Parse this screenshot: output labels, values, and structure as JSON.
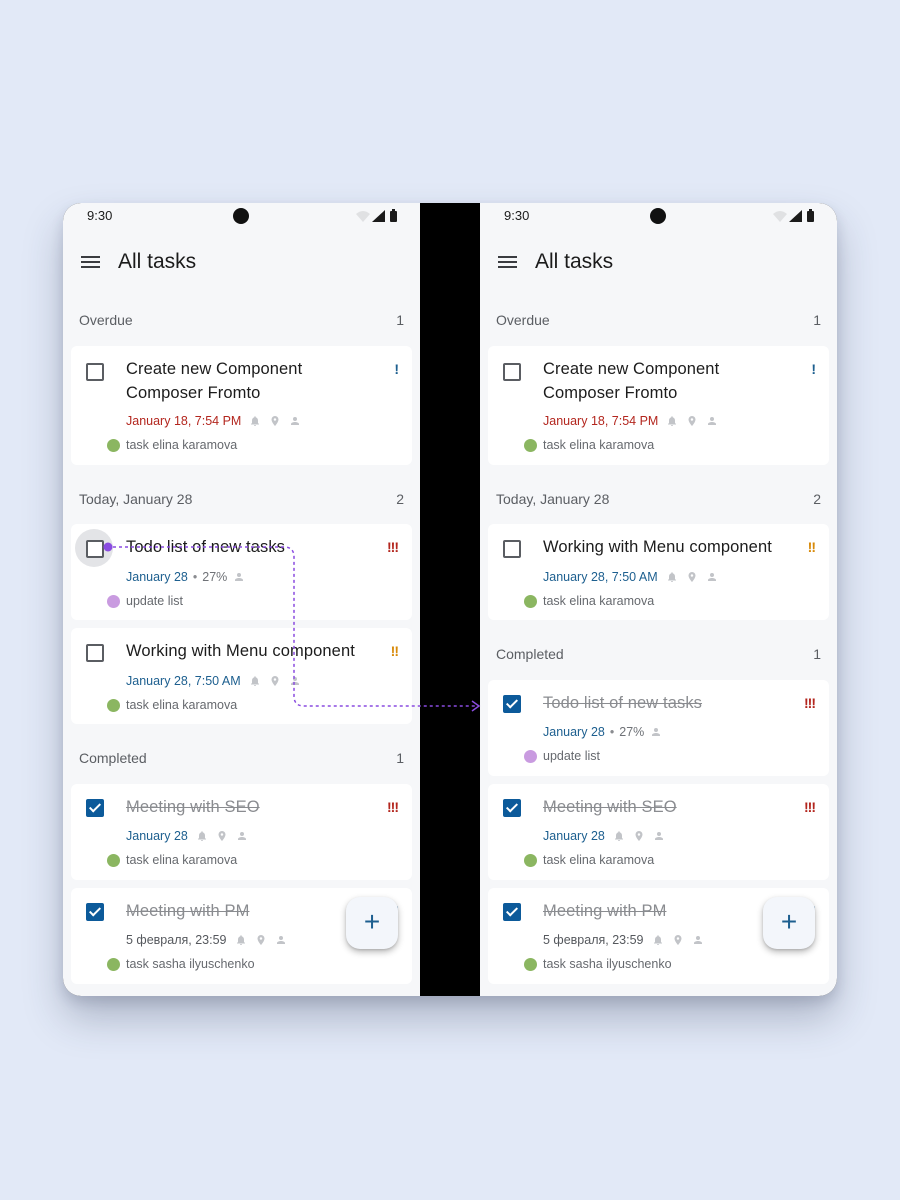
{
  "status": {
    "time": "9:30"
  },
  "appbar": {
    "title": "All tasks"
  },
  "colors": {
    "background": "#e2e9f7",
    "accent": "#0c5a9a",
    "date": "#1d5f8f",
    "overdue": "#b3261e",
    "priority_high": "#b3261e",
    "priority_medium": "#d88a0a",
    "priority_low": "#1d5f8f",
    "tag_green": "#8bb661",
    "tag_purple": "#c99be0",
    "drag_path": "#8a4ce0"
  },
  "left": {
    "sections": {
      "overdue": {
        "label": "Overdue",
        "count": "1"
      },
      "today": {
        "label": "Today, January 28",
        "count": "2"
      },
      "completed": {
        "label": "Completed",
        "count": "1"
      }
    },
    "tasks": [
      {
        "title_line1": "Create new Component",
        "title_line2": "Composer Fromto",
        "priority": "!",
        "date": "January 18, 7:54 PM",
        "tag": "task elina karamova",
        "checked": false
      },
      {
        "title": "Todo list of new tasks",
        "priority": "!!!",
        "date": "January 28",
        "progress": "27%",
        "tag": "update list",
        "checked": false
      },
      {
        "title": "Working with Menu component",
        "priority": "!!",
        "date": "January 28, 7:50 AM",
        "tag": "task elina karamova",
        "checked": false
      },
      {
        "title": "Meeting with SEO",
        "priority": "!!!",
        "date": "January 28",
        "tag": "task elina karamova",
        "checked": true
      },
      {
        "title": "Meeting with PM",
        "priority": "!",
        "date": "5 февраля, 23:59",
        "tag": "task sasha ilyuschenko",
        "checked": true
      }
    ],
    "fab_label": "+"
  },
  "right": {
    "sections": {
      "overdue": {
        "label": "Overdue",
        "count": "1"
      },
      "today": {
        "label": "Today, January 28",
        "count": "2"
      },
      "completed": {
        "label": "Completed",
        "count": "1"
      }
    },
    "tasks": [
      {
        "title_line1": "Create new Component",
        "title_line2": "Composer Fromto",
        "priority": "!",
        "date": "January 18, 7:54 PM",
        "tag": "task elina karamova",
        "checked": false
      },
      {
        "title": "Working with Menu component",
        "priority": "!!",
        "date": "January 28, 7:50 AM",
        "tag": "task elina karamova",
        "checked": false
      },
      {
        "title": "Todo list of new tasks",
        "priority": "!!!",
        "date": "January 28",
        "progress": "27%",
        "tag": "update list",
        "checked": true
      },
      {
        "title": "Meeting with SEO",
        "priority": "!!!",
        "date": "January 28",
        "tag": "task elina karamova",
        "checked": true
      },
      {
        "title": "Meeting with PM",
        "priority": "!",
        "date": "5 февраля, 23:59",
        "tag": "task sasha ilyuschenko",
        "checked": true
      }
    ],
    "fab_label": "+"
  }
}
